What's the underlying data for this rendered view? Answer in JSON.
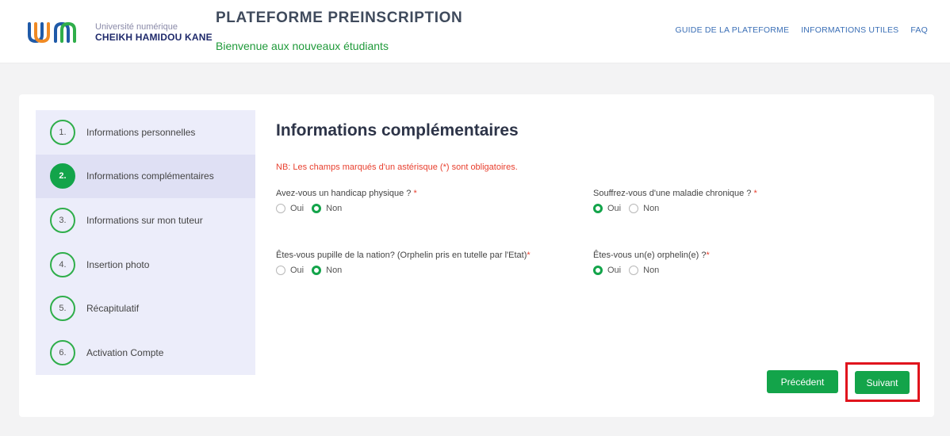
{
  "header": {
    "logo_line1": "Université numérique",
    "logo_line2": "CHEIKH HAMIDOU KANE",
    "title": "PLATEFORME PREINSCRIPTION",
    "subtitle": "Bienvenue aux nouveaux étudiants",
    "nav": [
      {
        "label": "GUIDE DE LA PLATEFORME"
      },
      {
        "label": "INFORMATIONS UTILES"
      },
      {
        "label": "FAQ"
      }
    ]
  },
  "steps": [
    {
      "num": "1.",
      "label": "Informations personnelles",
      "active": false
    },
    {
      "num": "2.",
      "label": "Informations complémentaires",
      "active": true
    },
    {
      "num": "3.",
      "label": "Informations sur mon tuteur",
      "active": false
    },
    {
      "num": "4.",
      "label": "Insertion photo",
      "active": false
    },
    {
      "num": "5.",
      "label": "Récapitulatif",
      "active": false
    },
    {
      "num": "6.",
      "label": "Activation Compte",
      "active": false
    }
  ],
  "form": {
    "title": "Informations complémentaires",
    "note": "NB: Les champs marqués d'un astérisque (*) sont obligatoires.",
    "required_marker": "*",
    "questions": [
      {
        "label": "Avez-vous un handicap physique ? ",
        "selected": "Non"
      },
      {
        "label": "Souffrez-vous d'une maladie chronique ? ",
        "selected": "Oui"
      },
      {
        "label": "Êtes-vous pupille de la nation? (Orphelin pris en tutelle par l'Etat)",
        "selected": "Non"
      },
      {
        "label": "Êtes-vous un(e) orphelin(e) ?",
        "selected": "Oui"
      }
    ],
    "option_yes": "Oui",
    "option_no": "Non"
  },
  "buttons": {
    "previous": "Précédent",
    "next": "Suivant"
  },
  "colors": {
    "accent_green": "#13a44a",
    "highlight_red": "#e0141d",
    "required_red": "#e8402f",
    "step_bg": "#ecedfa"
  }
}
